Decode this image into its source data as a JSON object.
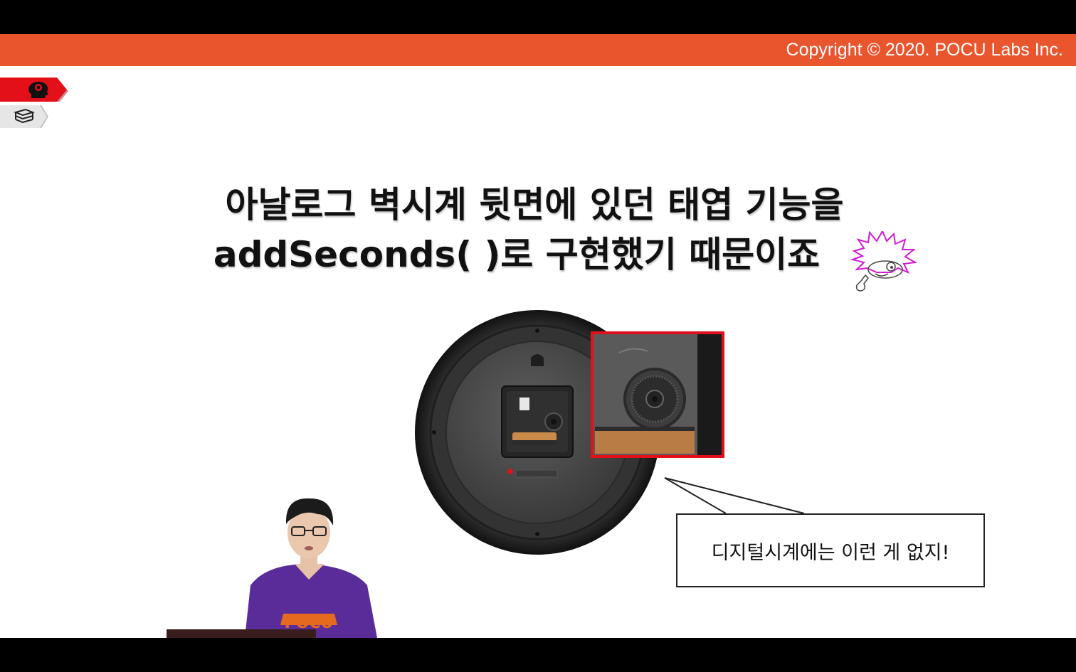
{
  "header": {
    "copyright": "Copyright © 2020. POCU Labs Inc.",
    "color": "#e9552d"
  },
  "nav_tabs": [
    {
      "icon": "brain-head-icon",
      "color": "#e3101a"
    },
    {
      "icon": "book-stack-icon",
      "color": "#e6e6e6"
    }
  ],
  "title": {
    "line1": "아날로그 벽시계 뒷면에 있던 태엽 기능을",
    "line2": "addSeconds( )로 구현했기 때문이죠"
  },
  "speech_bubble": {
    "text": "디지털시계에는 이런 게 없지!"
  },
  "presenter": {
    "shirt_text": "POCU"
  }
}
